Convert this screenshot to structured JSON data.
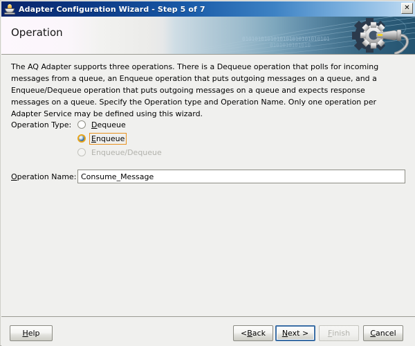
{
  "window": {
    "title": "Adapter Configuration Wizard - Step 5 of 7",
    "icon": "coffee-cup-icon",
    "close_label": "✕",
    "accent_title_color": "#0a246a"
  },
  "banner": {
    "title": "Operation",
    "binary_row1": "0101010101010101010101010101",
    "binary_row2": "0101010101010",
    "graphic": "gear-wrench-icon"
  },
  "body": {
    "description": "The AQ Adapter supports three operations.  There is a Dequeue operation that polls for incoming messages from a queue, an Enqueue operation that puts outgoing messages on a queue, and a Enqueue/Dequeue operation that puts outgoing messages on a queue and expects response messages on a queue.  Specify the Operation type and Operation Name. Only one operation per Adapter Service may be defined using this wizard."
  },
  "operation_type": {
    "label": "Operation Type:",
    "options": [
      {
        "label_pre": "",
        "mnemonic": "D",
        "label_post": "equeue",
        "selected": false,
        "disabled": false
      },
      {
        "label_pre": "",
        "mnemonic": "E",
        "label_post": "nqueue",
        "selected": true,
        "disabled": false
      },
      {
        "label_pre": "",
        "mnemonic": "",
        "label_post": "Enqueue/Dequeue",
        "selected": false,
        "disabled": true
      }
    ],
    "selected_value": "Enqueue",
    "focus_color": "#e8901c"
  },
  "operation_name": {
    "label_pre": "",
    "label_mnemonic": "O",
    "label_post": "peration Name:",
    "value": "Consume_Message",
    "placeholder": ""
  },
  "buttons": {
    "help": {
      "pre": "",
      "mn": "H",
      "post": "elp",
      "disabled": false,
      "focused": false
    },
    "back": {
      "pre": "< ",
      "mn": "B",
      "post": "ack",
      "disabled": false,
      "focused": false
    },
    "next": {
      "pre": "",
      "mn": "N",
      "post": "ext >",
      "disabled": false,
      "focused": true
    },
    "finish": {
      "pre": "",
      "mn": "F",
      "post": "inish",
      "disabled": true,
      "focused": false
    },
    "cancel": {
      "pre": "",
      "mn": "C",
      "post": "ancel",
      "disabled": false,
      "focused": false
    }
  }
}
